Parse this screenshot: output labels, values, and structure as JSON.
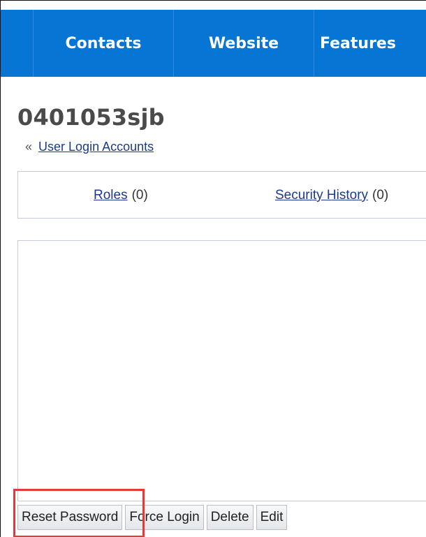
{
  "nav": {
    "items": [
      {
        "label": "Contacts"
      },
      {
        "label": "Website"
      },
      {
        "label": "Features"
      }
    ]
  },
  "page": {
    "title": "0401053sjb",
    "breadcrumb": {
      "arrow": "«",
      "link": "User Login Accounts"
    }
  },
  "tabs": [
    {
      "label": "Roles",
      "count": "(0)"
    },
    {
      "label": "Security History",
      "count": "(0)"
    }
  ],
  "actions": {
    "reset_password": "Reset Password",
    "force_login": "Force Login",
    "delete": "Delete",
    "edit": "Edit"
  },
  "colors": {
    "nav_background": "#0775d3",
    "highlight": "#e53935",
    "link": "#1a3a8f"
  }
}
